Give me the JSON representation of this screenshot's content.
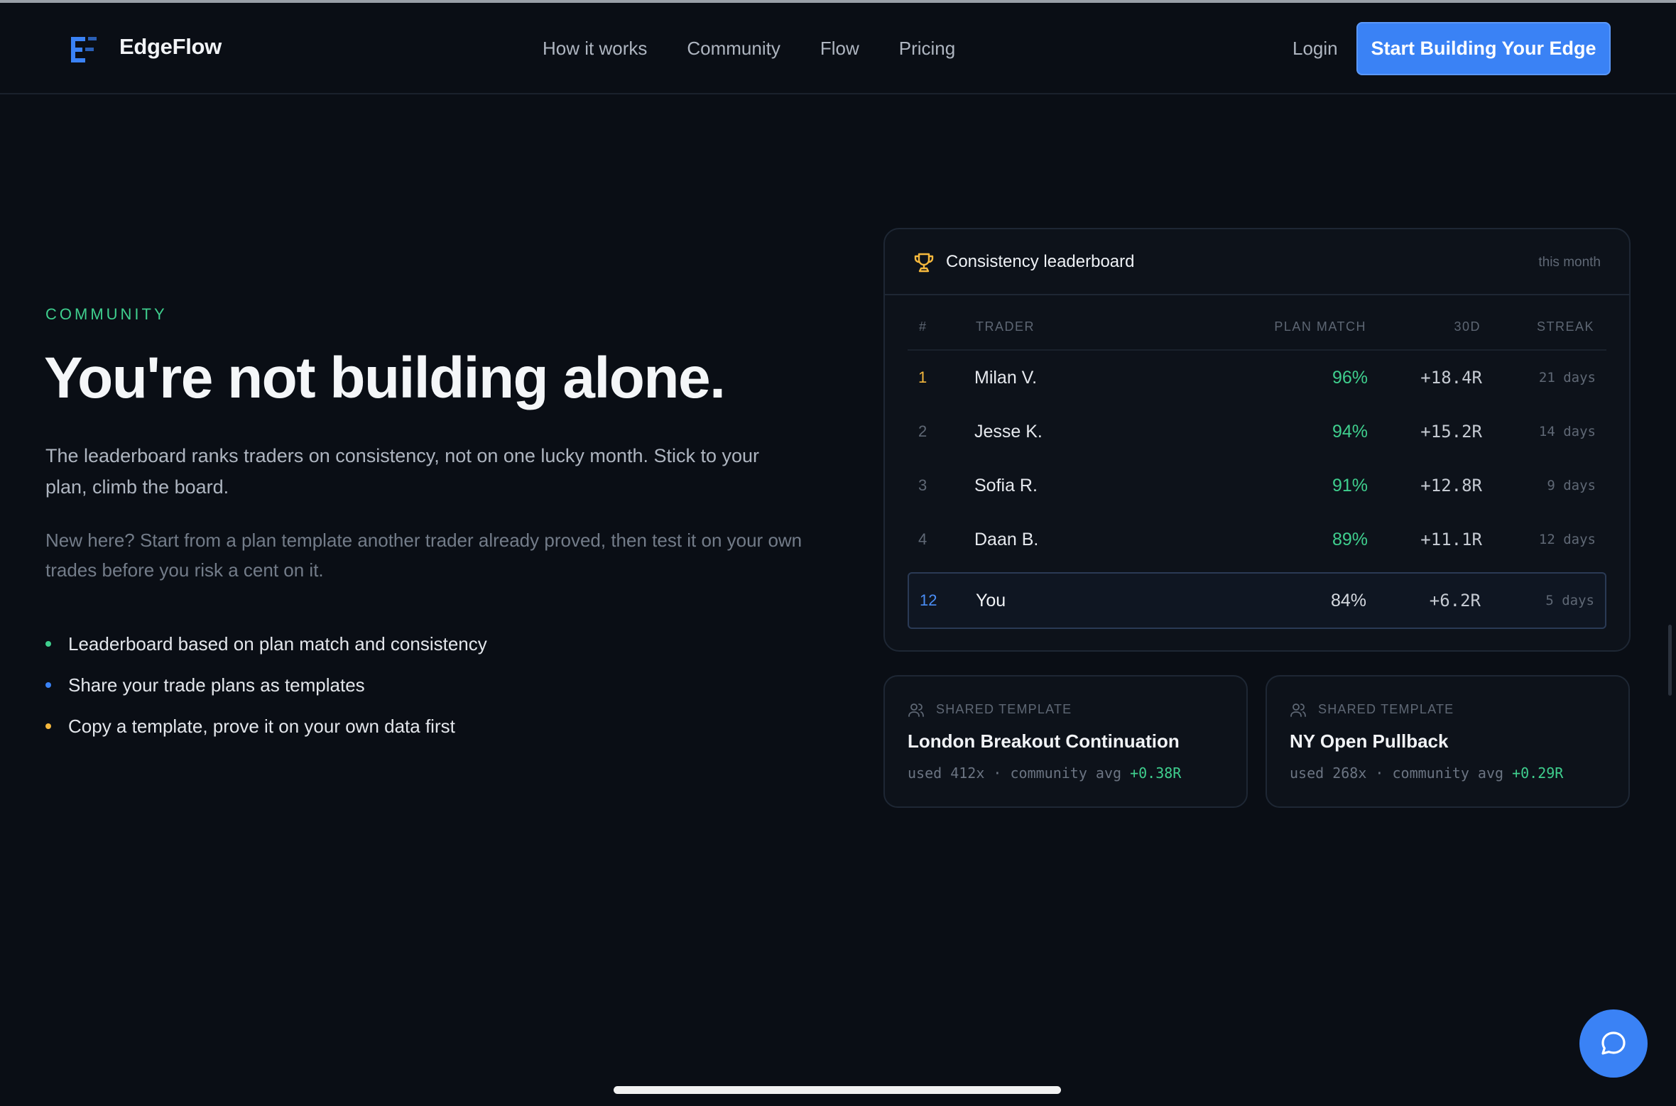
{
  "nav": {
    "brand": "EdgeFlow",
    "links": [
      "How it works",
      "Community",
      "Flow",
      "Pricing"
    ],
    "login": "Login",
    "cta": "Start Building Your Edge"
  },
  "hero": {
    "eyebrow": "COMMUNITY",
    "headline": "You're not building alone.",
    "lede": "The leaderboard ranks traders on consistency, not on one lucky month. Stick to your plan, climb the board.",
    "sub": "New here? Start from a plan template another trader already proved, then test it on your own trades before you risk a cent on it.",
    "bullets": [
      {
        "text": "Leaderboard based on plan match and consistency",
        "color": "#3fcf8e"
      },
      {
        "text": "Share your trade plans as templates",
        "color": "#3a82f5"
      },
      {
        "text": "Copy a template, prove it on your own data first",
        "color": "#f5b83d"
      }
    ]
  },
  "leaderboard": {
    "icon": "trophy-icon",
    "title": "Consistency leaderboard",
    "period": "this month",
    "columns": [
      "#",
      "TRADER",
      "PLAN MATCH",
      "30D",
      "STREAK"
    ],
    "rows": [
      {
        "rank": "1",
        "name": "Milan V.",
        "match": "96%",
        "r": "+18.4R",
        "streak": "21 days"
      },
      {
        "rank": "2",
        "name": "Jesse K.",
        "match": "94%",
        "r": "+15.2R",
        "streak": "14 days"
      },
      {
        "rank": "3",
        "name": "Sofia R.",
        "match": "91%",
        "r": "+12.8R",
        "streak": "9 days"
      },
      {
        "rank": "4",
        "name": "Daan B.",
        "match": "89%",
        "r": "+11.1R",
        "streak": "12 days"
      }
    ],
    "you": {
      "rank": "12",
      "name": "You",
      "match": "84%",
      "r": "+6.2R",
      "streak": "5 days"
    },
    "colors": {
      "top_rank": "#f5b83d",
      "rank": "#5f6875",
      "you_rank": "#4a8ef7",
      "match_good": "#3fcf8e",
      "match_you": "#d6dae0"
    }
  },
  "templates": [
    {
      "eyebrow": "SHARED TEMPLATE",
      "title": "London Breakout Continuation",
      "meta_prefix": "used 412x · community avg ",
      "avg": "+0.38R"
    },
    {
      "eyebrow": "SHARED TEMPLATE",
      "title": "NY Open Pullback",
      "meta_prefix": "used 268x · community avg ",
      "avg": "+0.29R"
    }
  ],
  "chat": {
    "icon": "chat-bubble-icon"
  }
}
